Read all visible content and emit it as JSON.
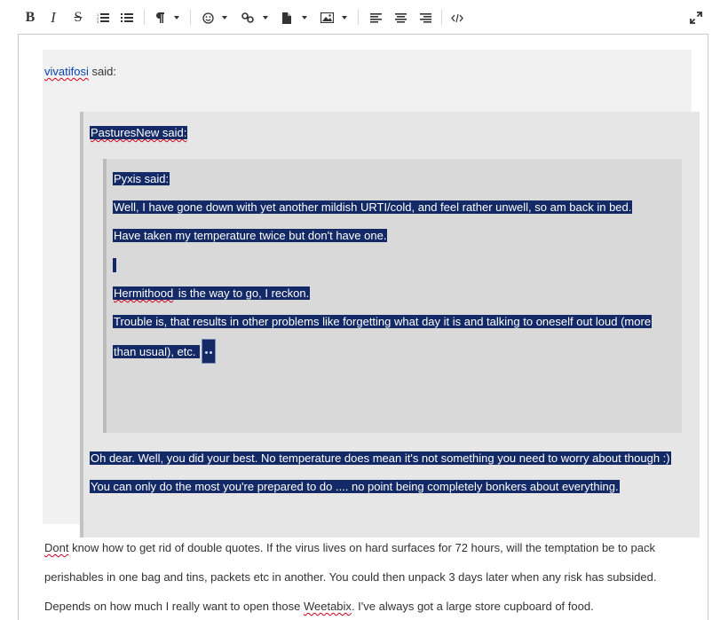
{
  "toolbar": {
    "bold_label": "B",
    "italic_label": "I",
    "strike_label": "S",
    "icons": [
      "bold",
      "italic",
      "strikethrough",
      "ordered-list-icon",
      "unordered-list-icon",
      "paragraph-format-icon",
      "emoji-icon",
      "link-icon",
      "insert-file-icon",
      "insert-image-icon",
      "align-left-icon",
      "align-center-icon",
      "align-right-icon",
      "code-view-icon",
      "fullscreen-icon"
    ]
  },
  "quote_level1": {
    "author_link": "vivatifosi",
    "said": " said:"
  },
  "quote_level2": {
    "author": "PasturesNew said:",
    "lines": [
      "Oh dear. Well, you did your best.  No temperature does mean it's not something you need to worry about though :)",
      "You can only do the most you're prepared to do .... no point being completely bonkers about everything. "
    ]
  },
  "quote_level3": {
    "author": "Pyxis said:",
    "line1": "Well, I have gone down with yet another mildish URTI/cold, and feel rather unwell, so am back in bed.",
    "line2": "Have taken my temperature twice but don't have one.",
    "line3a": "Hermithood",
    "line3b": " is the way to go, I reckon.",
    "line4": "Trouble is, that results in other problems like  forgetting what day it is and talking to oneself out loud (more ",
    "line5": "than usual), etc. "
  },
  "reply": {
    "l1a": "Dont",
    "l1b": " know how to get rid of double quotes. If the virus lives on hard surfaces for 72 hours, will the temptation be to pack",
    "l2": "perishables in one bag and tins, packets etc in another. You could then unpack 3 days later when any risk has subsided.",
    "l3a": "Depends on how much I really want to open those ",
    "l3b": "Weetabix",
    "l3c": ".  I've always got a large store cupboard of food."
  },
  "colors": {
    "selection": "#142a66",
    "spellcheck": "#d0021b",
    "link": "#0645ad"
  }
}
